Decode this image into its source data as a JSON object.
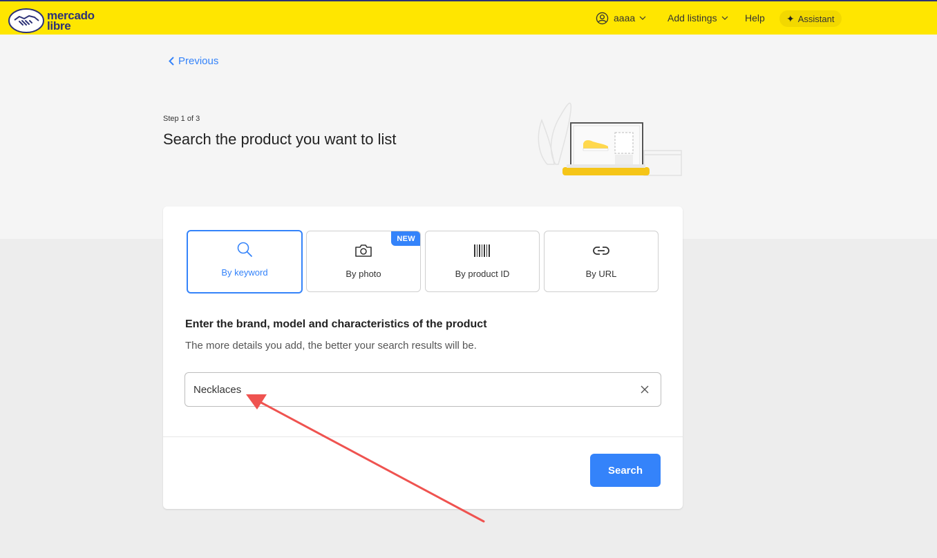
{
  "header": {
    "logo_line1": "mercado",
    "logo_line2": "libre",
    "user_name": "aaaa",
    "add_listings": "Add listings",
    "help": "Help",
    "assistant": "Assistant"
  },
  "nav": {
    "previous": "Previous"
  },
  "page": {
    "step": "Step 1 of 3",
    "title": "Search the product you want to list"
  },
  "methods": [
    {
      "label": "By keyword",
      "icon": "search-icon",
      "active": true
    },
    {
      "label": "By photo",
      "icon": "camera-icon",
      "badge": "NEW"
    },
    {
      "label": "By product ID",
      "icon": "barcode-icon"
    },
    {
      "label": "By URL",
      "icon": "link-icon"
    }
  ],
  "form": {
    "heading": "Enter the brand, model and characteristics of the product",
    "hint": "The more details you add, the better your search results will be.",
    "search_value": "Necklaces",
    "search_button": "Search"
  },
  "colors": {
    "header_bg": "#ffe600",
    "accent": "#3483fa",
    "annotation_arrow": "#ef5350"
  }
}
